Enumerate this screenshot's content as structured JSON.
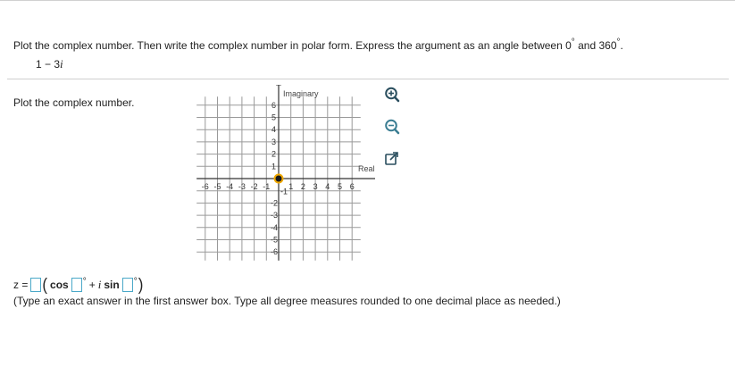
{
  "question": {
    "text_part1": "Plot the complex number.  Then write the complex number in polar form.  Express the argument as an angle between 0",
    "text_mid": " and 360",
    "text_end": ".",
    "degree": "°",
    "number_real": "1 − 3",
    "number_imag_unit": "i"
  },
  "part": {
    "prompt": "Plot the complex number."
  },
  "graph": {
    "y_axis_label": "Imaginary",
    "x_axis_label": "Real",
    "x_ticks_neg": [
      "-6",
      "-5",
      "-4",
      "-3",
      "-2",
      "-1"
    ],
    "x_ticks_pos": [
      "1",
      "2",
      "3",
      "4",
      "5",
      "6"
    ],
    "y_ticks_pos": [
      "6",
      "5",
      "4",
      "3",
      "2",
      "1"
    ],
    "y_ticks_neg": [
      "-2",
      "-3",
      "-4",
      "-5",
      "-6"
    ],
    "y_tick_minus1": "-1",
    "point_color": "#1a1a1a",
    "point_ring_color": "#f0a800"
  },
  "tools": {
    "zoom_in": "zoom-in-icon",
    "zoom_out": "zoom-out-icon",
    "expand": "expand-icon"
  },
  "answer": {
    "z_label": "z =",
    "cos_label": "cos",
    "sin_label": "sin",
    "i_label": "i",
    "plus": "+",
    "degree": "°",
    "open_paren": "(",
    "close_paren": ")"
  },
  "note": "(Type an exact answer in the first answer box. Type all degree measures rounded to one decimal place as needed.)"
}
